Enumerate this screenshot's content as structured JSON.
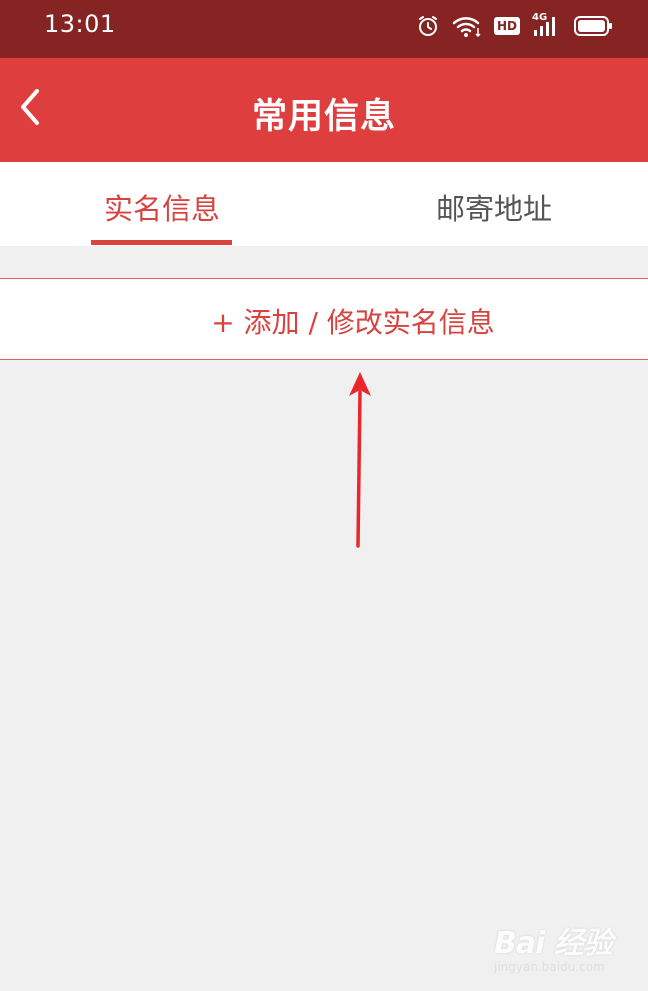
{
  "status_bar": {
    "time": "13:01",
    "hd_label": "HD",
    "network_label": "4G"
  },
  "header": {
    "title": "常用信息"
  },
  "tabs": [
    {
      "label": "实名信息",
      "active": true
    },
    {
      "label": "邮寄地址",
      "active": false
    }
  ],
  "actions": {
    "add_label": "+ 添加 / 修改实名信息"
  },
  "watermark": {
    "logo_text": "Bai 经验",
    "sub_text": "jingyan.baidu.com"
  },
  "colors": {
    "status_bar": "#852423",
    "header": "#de3e3e",
    "accent": "#d8433f",
    "background": "#f0f0f0"
  }
}
